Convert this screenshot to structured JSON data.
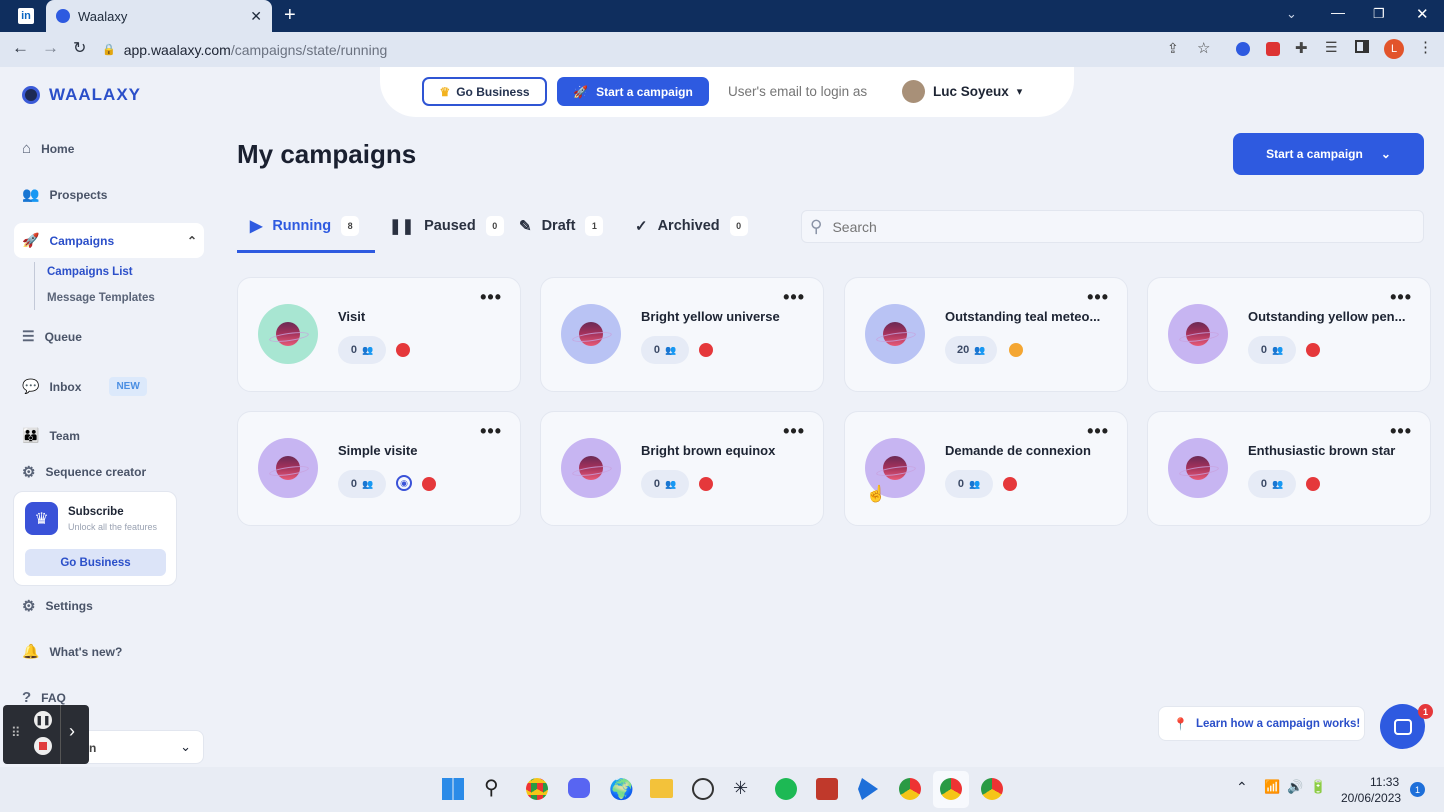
{
  "browser": {
    "tab_title": "Waalaxy",
    "url_domain": "app.waalaxy.com",
    "url_path": "/campaigns/state/running",
    "profile_initial": "L"
  },
  "brand": {
    "name": "WAALAXY"
  },
  "header": {
    "go_business": "Go Business",
    "start_campaign": "Start a campaign",
    "login_as_placeholder": "User's email to login as",
    "user_name": "Luc Soyeux"
  },
  "sidebar": {
    "home": "Home",
    "prospects": "Prospects",
    "campaigns": "Campaigns",
    "campaigns_list": "Campaigns List",
    "message_templates": "Message Templates",
    "queue": "Queue",
    "inbox": "Inbox",
    "inbox_badge": "NEW",
    "team": "Team",
    "sequence_creator": "Sequence creator",
    "subscribe_title": "Subscribe",
    "subscribe_sub": "Unlock all the features",
    "subscribe_btn": "Go Business",
    "settings": "Settings",
    "whats_new": "What's new?",
    "faq": "FAQ",
    "bottom_select_partial": "n"
  },
  "main": {
    "title": "My campaigns",
    "start_campaign": "Start a campaign",
    "search_placeholder": "Search",
    "tabs": [
      {
        "label": "Running",
        "count": "8"
      },
      {
        "label": "Paused",
        "count": "0"
      },
      {
        "label": "Draft",
        "count": "1"
      },
      {
        "label": "Archived",
        "count": "0"
      }
    ]
  },
  "campaigns": [
    {
      "name": "Visit",
      "prospects": "0",
      "status_color": "#e5383b",
      "avatar_color": "#a8e6d2"
    },
    {
      "name": "Bright yellow universe",
      "prospects": "0",
      "status_color": "#e5383b",
      "avatar_color": "#b9c3f4"
    },
    {
      "name": "Outstanding teal meteo...",
      "prospects": "20",
      "status_color": "#f4a632",
      "avatar_color": "#b9c3f4"
    },
    {
      "name": "Outstanding yellow pen...",
      "prospects": "0",
      "status_color": "#e5383b",
      "avatar_color": "#c7b5f2"
    },
    {
      "name": "Simple visite",
      "prospects": "0",
      "status_color": "#e5383b",
      "avatar_color": "#c7b5f2"
    },
    {
      "name": "Bright brown equinox",
      "prospects": "0",
      "status_color": "#e5383b",
      "avatar_color": "#c7b5f2"
    },
    {
      "name": "Demande de connexion",
      "prospects": "0",
      "status_color": "#e5383b",
      "avatar_color": "#c7b5f2"
    },
    {
      "name": "Enthusiastic brown star",
      "prospects": "0",
      "status_color": "#e5383b",
      "avatar_color": "#c7b5f2"
    }
  ],
  "help": {
    "learn": "Learn how a campaign works!",
    "chat_badge": "1"
  },
  "taskbar": {
    "time": "11:33",
    "date": "20/06/2023",
    "notif": "1"
  }
}
